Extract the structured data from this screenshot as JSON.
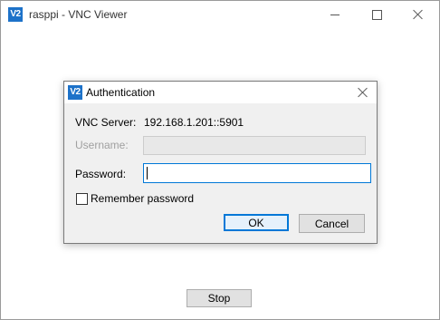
{
  "window": {
    "title": "rasppi - VNC Viewer",
    "icon": "vnc-viewer-icon",
    "icon_text": "V2"
  },
  "main": {
    "stop_label": "Stop"
  },
  "dialog": {
    "title": "Authentication",
    "icon": "vnc-viewer-icon",
    "icon_text": "V2",
    "server_label": "VNC Server:",
    "server_value": "192.168.1.201::5901",
    "username_label": "Username:",
    "username_value": "",
    "password_label": "Password:",
    "password_value": "",
    "remember_label": "Remember password",
    "remember_checked": false,
    "ok_label": "OK",
    "cancel_label": "Cancel"
  },
  "colors": {
    "accent": "#0078d7",
    "icon_bg": "#1d72c9",
    "dialog_bg": "#f0f0f0"
  }
}
